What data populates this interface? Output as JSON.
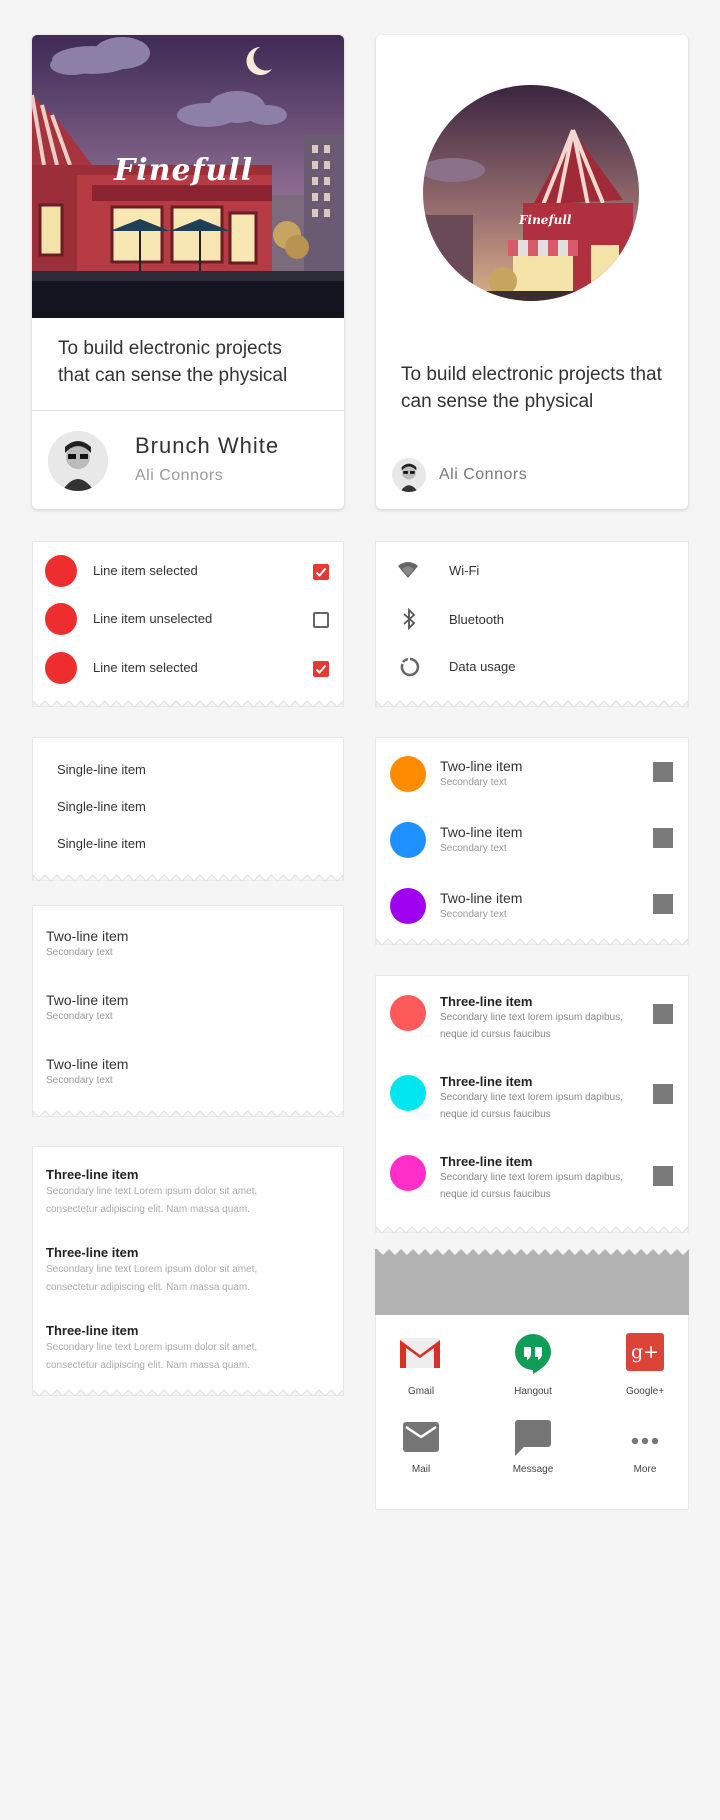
{
  "card1": {
    "sign": "Finefull",
    "body": "To build electronic projects that can sense the physical",
    "title": "Brunch White",
    "subtitle": "Ali Connors"
  },
  "card2": {
    "sign": "Finefull",
    "body": "To build electronic projects that can sense the physical",
    "subtitle": "Ali Connors"
  },
  "checklist": {
    "items": [
      {
        "label": "Line item selected",
        "checked": true
      },
      {
        "label": "Line item unselected",
        "checked": false
      },
      {
        "label": "Line item selected",
        "checked": true
      }
    ],
    "dot_color": "#ee2e2e",
    "check_color": "#e53935"
  },
  "settings": {
    "items": [
      {
        "label": "Wi-Fi",
        "icon": "wifi-icon"
      },
      {
        "label": "Bluetooth",
        "icon": "bluetooth-icon"
      },
      {
        "label": "Data usage",
        "icon": "data-usage-icon"
      }
    ]
  },
  "single_list": {
    "items": [
      "Single-line item",
      "Single-line item",
      "Single-line item"
    ]
  },
  "two_line_avatar": {
    "items": [
      {
        "primary": "Two-line item",
        "secondary": "Secondary text",
        "color": "#ff8c00"
      },
      {
        "primary": "Two-line item",
        "secondary": "Secondary text",
        "color": "#1e90ff"
      },
      {
        "primary": "Two-line item",
        "secondary": "Secondary text",
        "color": "#a000f0"
      }
    ]
  },
  "two_line": {
    "items": [
      {
        "primary": "Two-line item",
        "secondary": "Secondary text"
      },
      {
        "primary": "Two-line item",
        "secondary": "Secondary text"
      },
      {
        "primary": "Two-line item",
        "secondary": "Secondary text"
      }
    ]
  },
  "three_line_avatar": {
    "items": [
      {
        "primary": "Three-line item",
        "line1": "Secondary line text lorem ipsum dapibus,",
        "line2": "neque id cursus faucibus",
        "color": "#ff5a5a"
      },
      {
        "primary": "Three-line item",
        "line1": "Secondary line text lorem ipsum dapibus,",
        "line2": "neque id cursus faucibus",
        "color": "#00e5ee"
      },
      {
        "primary": "Three-line item",
        "line1": "Secondary line text lorem ipsum dapibus,",
        "line2": "neque id cursus faucibus",
        "color": "#ff2ec8"
      }
    ]
  },
  "three_line": {
    "items": [
      {
        "primary": "Three-line item",
        "line1": "Secondary line text Lorem ipsum dolor sit amet,",
        "line2": "consectetur adipiscing elit. Nam massa quam."
      },
      {
        "primary": "Three-line item",
        "line1": "Secondary line text Lorem ipsum dolor sit amet,",
        "line2": "consectetur adipiscing elit. Nam massa quam."
      },
      {
        "primary": "Three-line item",
        "line1": "Secondary line text Lorem ipsum dolor sit amet,",
        "line2": "consectetur adipiscing elit. Nam massa quam."
      }
    ]
  },
  "share": {
    "items": [
      {
        "label": "Gmail",
        "icon": "gmail-icon"
      },
      {
        "label": "Hangout",
        "icon": "hangout-icon"
      },
      {
        "label": "Google+",
        "icon": "google-plus-icon"
      },
      {
        "label": "Mail",
        "icon": "mail-icon"
      },
      {
        "label": "Message",
        "icon": "message-icon"
      },
      {
        "label": "More",
        "icon": "more-icon"
      }
    ],
    "gplus_glyph": "g+"
  }
}
